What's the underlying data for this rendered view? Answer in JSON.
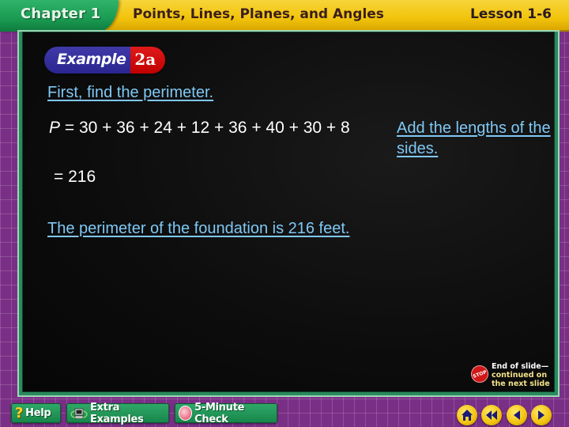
{
  "header": {
    "chapter": "Chapter 1",
    "title": "Points, Lines, Planes, and Angles",
    "lesson": "Lesson 1-6"
  },
  "slide": {
    "example_word": "Example",
    "example_number": "2a",
    "step": "First, find the perimeter.",
    "equation": {
      "variable": "P",
      "expression": "= 30 + 36 + 24 + 12 + 36 + 40 + 30 + 8",
      "result": "= 216"
    },
    "note": "Add the lengths of the sides.",
    "conclusion": "The perimeter of the foundation is 216 feet.",
    "end_note": {
      "stop_label": "STOP",
      "line1": "End of slide—",
      "line2": "continued on",
      "line3": "the next slide"
    }
  },
  "footer": {
    "buttons": [
      {
        "label": "Help",
        "icon": "question-mark-icon"
      },
      {
        "label": "Extra Examples",
        "icon": "computer-icon"
      },
      {
        "label": "5-Minute Check",
        "icon": "clock-icon"
      }
    ],
    "nav": [
      "home-icon",
      "first-slide-icon",
      "previous-slide-icon",
      "next-slide-icon"
    ]
  },
  "colors": {
    "header_yellow": "#f2c40c",
    "chapter_green": "#1a9a52",
    "background_purple": "#7a2f86",
    "link_blue": "#7fc8f5",
    "example_blue": "#2a2590",
    "example_red": "#c00000"
  }
}
